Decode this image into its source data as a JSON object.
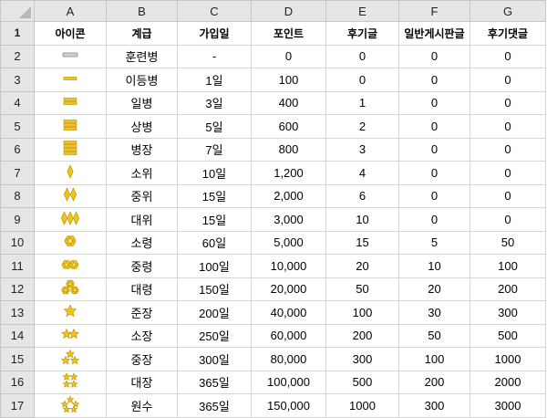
{
  "column_headers": [
    "A",
    "B",
    "C",
    "D",
    "E",
    "F",
    "G"
  ],
  "row_numbers": [
    "1",
    "2",
    "3",
    "4",
    "5",
    "6",
    "7",
    "8",
    "9",
    "10",
    "11",
    "12",
    "13",
    "14",
    "15",
    "16",
    "17"
  ],
  "titles": {
    "icon": "아이콘",
    "rank": "계급",
    "join": "가입일",
    "points": "포인트",
    "review_posts": "후기글",
    "general_posts": "일반게시판글",
    "review_comments": "후기댓글"
  },
  "rows": [
    {
      "icon": "gray-bar-icon",
      "rank": "훈련병",
      "join": "-",
      "points": "0",
      "review_posts": "0",
      "general_posts": "0",
      "review_comments": "0"
    },
    {
      "icon": "one-gold-bar-icon",
      "rank": "이등병",
      "join": "1일",
      "points": "100",
      "review_posts": "0",
      "general_posts": "0",
      "review_comments": "0"
    },
    {
      "icon": "two-gold-bars-icon",
      "rank": "일병",
      "join": "3일",
      "points": "400",
      "review_posts": "1",
      "general_posts": "0",
      "review_comments": "0"
    },
    {
      "icon": "three-gold-bars-icon",
      "rank": "상병",
      "join": "5일",
      "points": "600",
      "review_posts": "2",
      "general_posts": "0",
      "review_comments": "0"
    },
    {
      "icon": "four-gold-bars-icon",
      "rank": "병장",
      "join": "7일",
      "points": "800",
      "review_posts": "3",
      "general_posts": "0",
      "review_comments": "0"
    },
    {
      "icon": "one-diamond-icon",
      "rank": "소위",
      "join": "10일",
      "points": "1,200",
      "review_posts": "4",
      "general_posts": "0",
      "review_comments": "0"
    },
    {
      "icon": "two-diamonds-icon",
      "rank": "중위",
      "join": "15일",
      "points": "2,000",
      "review_posts": "6",
      "general_posts": "0",
      "review_comments": "0"
    },
    {
      "icon": "three-diamonds-icon",
      "rank": "대위",
      "join": "15일",
      "points": "3,000",
      "review_posts": "10",
      "general_posts": "0",
      "review_comments": "0"
    },
    {
      "icon": "one-flower-icon",
      "rank": "소령",
      "join": "60일",
      "points": "5,000",
      "review_posts": "15",
      "general_posts": "5",
      "review_comments": "50"
    },
    {
      "icon": "two-flowers-icon",
      "rank": "중령",
      "join": "100일",
      "points": "10,000",
      "review_posts": "20",
      "general_posts": "10",
      "review_comments": "100"
    },
    {
      "icon": "three-flowers-icon",
      "rank": "대령",
      "join": "150일",
      "points": "20,000",
      "review_posts": "50",
      "general_posts": "20",
      "review_comments": "200"
    },
    {
      "icon": "one-star-icon",
      "rank": "준장",
      "join": "200일",
      "points": "40,000",
      "review_posts": "100",
      "general_posts": "30",
      "review_comments": "300"
    },
    {
      "icon": "two-stars-icon",
      "rank": "소장",
      "join": "250일",
      "points": "60,000",
      "review_posts": "200",
      "general_posts": "50",
      "review_comments": "500"
    },
    {
      "icon": "three-stars-icon",
      "rank": "중장",
      "join": "300일",
      "points": "80,000",
      "review_posts": "300",
      "general_posts": "100",
      "review_comments": "1000"
    },
    {
      "icon": "four-stars-icon",
      "rank": "대장",
      "join": "365일",
      "points": "100,000",
      "review_posts": "500",
      "general_posts": "200",
      "review_comments": "2000"
    },
    {
      "icon": "five-stars-icon",
      "rank": "원수",
      "join": "365일",
      "points": "150,000",
      "review_posts": "1000",
      "general_posts": "300",
      "review_comments": "3000"
    }
  ]
}
